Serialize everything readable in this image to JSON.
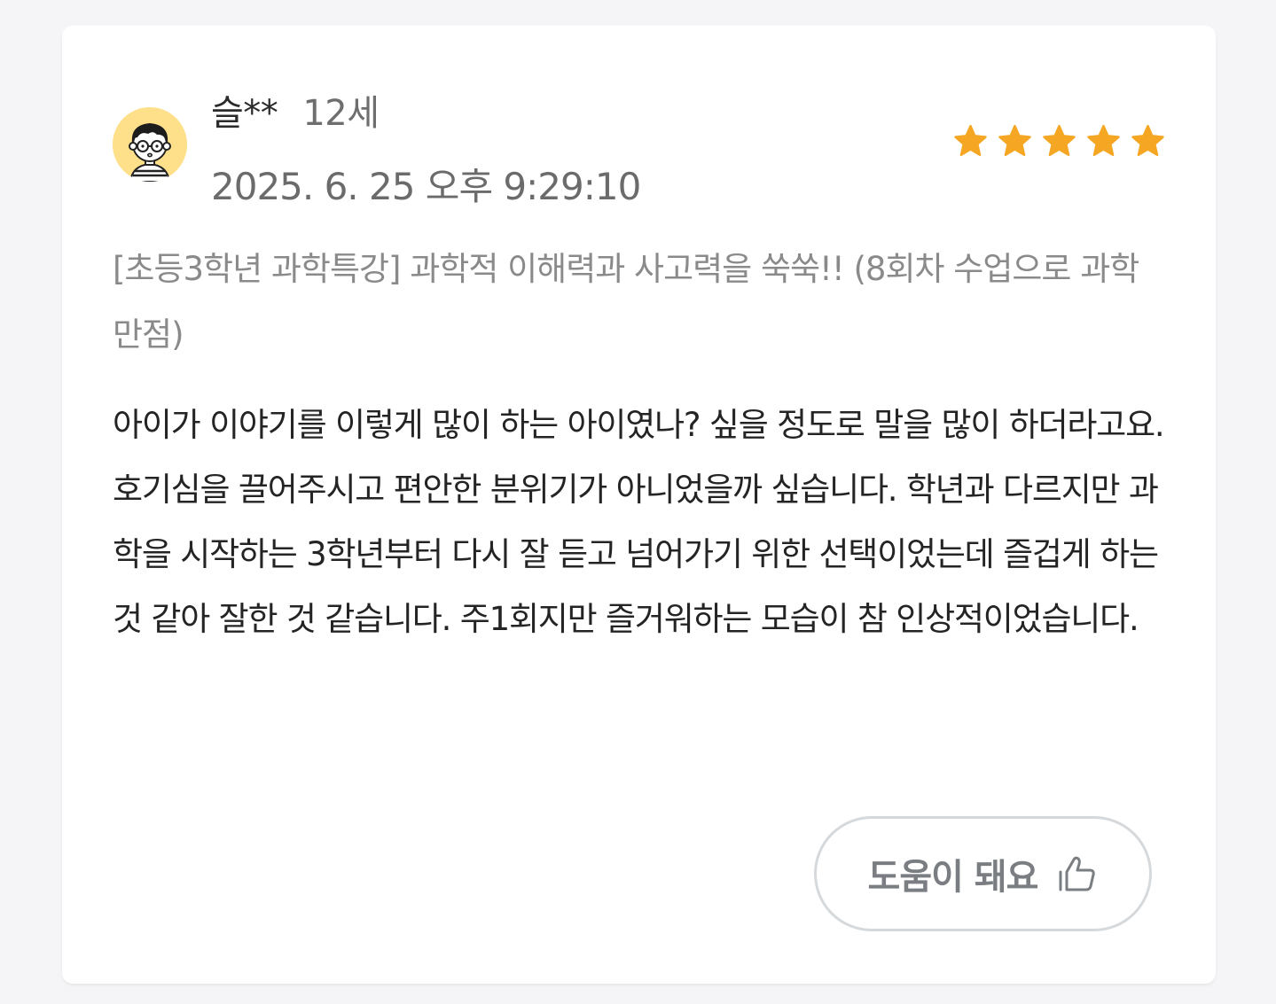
{
  "review": {
    "user_name": "슬**",
    "user_age": "12세",
    "date": "2025. 6. 25 오후 9:29:10",
    "rating": 5,
    "max_rating": 5,
    "course_title": "[초등3학년 과학특강] 과학적 이해력과 사고력을 쑥쑥!! (8회차 수업으로 과학만점)",
    "body": "아이가 이야기를 이렇게 많이 하는 아이였나? 싶을 정도로 말을 많이 하더라고요. 호기심을 끌어주시고 편안한 분위기가 아니었을까 싶습니다. 학년과 다르지만 과학을 시작하는 3학년부터 다시 잘 듣고 넘어가기 위한 선택이었는데 즐겁게 하는것 같아 잘한 것 같습니다. 주1회지만 즐거워하는 모습이 참 인상적이었습니다.",
    "helpful_label": "도움이 돼요"
  },
  "icons": {
    "avatar": "boy-with-glasses-avatar",
    "star": "star-icon",
    "helpful": "thumbs-up-icon"
  },
  "colors": {
    "star": "#f5a623",
    "avatar_bg": "#ffe08a",
    "button_border": "#d5d9dc",
    "button_text": "#7a7e82"
  }
}
